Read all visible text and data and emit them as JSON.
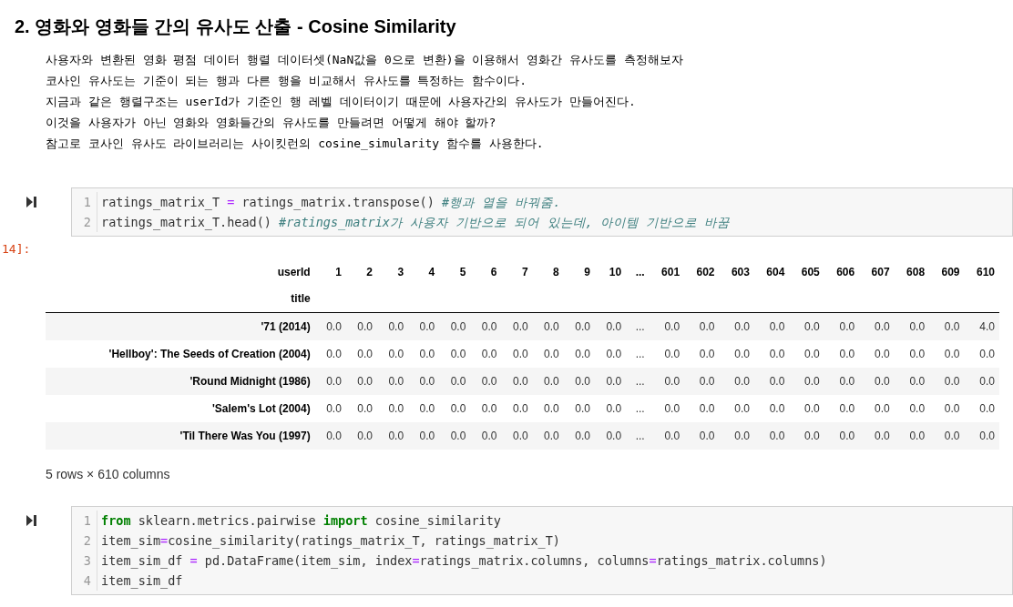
{
  "heading": "2. 영화와 영화들 간의 유사도 산출 - Cosine Similarity",
  "paragraphs": [
    "사용자와 변환된 영화 평점 데이터 행렬 데이터셋(NaN값을 0으로 변환)을 이용해서 영화간 유사도를 측정해보자",
    "코사인 유사도는 기준이 되는 행과 다른 행을 비교해서 유사도를 특정하는 함수이다.",
    "지금과 같은 행렬구조는 userId가 기준인 행 레벨 데이터이기 때문에 사용자간의 유사도가 만들어진다.",
    "이것을 사용자가 아닌 영화와 영화들간의 유사도를 만들려면 어떻게 해야 할까?",
    "참고로 코사인 유사도 라이브러리는 사이킷런의 cosine_simularity 함수를 사용한다."
  ],
  "cells": [
    {
      "prompt": "14]:",
      "lines": [
        {
          "number": "1",
          "tokens": [
            {
              "kind": "plain",
              "text": "ratings_matrix_T "
            },
            {
              "kind": "operator",
              "text": "="
            },
            {
              "kind": "plain",
              "text": " ratings_matrix.transpose() "
            },
            {
              "kind": "comment",
              "text": "#행과 열을 바꿔줌."
            }
          ]
        },
        {
          "number": "2",
          "tokens": [
            {
              "kind": "plain",
              "text": "ratings_matrix_T.head() "
            },
            {
              "kind": "comment",
              "text": "#ratings_matrix가 사용자 기반으로 되어 있는데, 아이템 기반으로 바꿈"
            }
          ]
        }
      ],
      "output": {
        "table": {
          "columns_name": "userId",
          "index_name": "title",
          "columns": [
            "1",
            "2",
            "3",
            "4",
            "5",
            "6",
            "7",
            "8",
            "9",
            "10",
            "...",
            "601",
            "602",
            "603",
            "604",
            "605",
            "606",
            "607",
            "608",
            "609",
            "610"
          ],
          "rows": [
            {
              "index": "'71 (2014)",
              "values": [
                "0.0",
                "0.0",
                "0.0",
                "0.0",
                "0.0",
                "0.0",
                "0.0",
                "0.0",
                "0.0",
                "0.0",
                "...",
                "0.0",
                "0.0",
                "0.0",
                "0.0",
                "0.0",
                "0.0",
                "0.0",
                "0.0",
                "0.0",
                "4.0"
              ]
            },
            {
              "index": "'Hellboy': The Seeds of Creation (2004)",
              "values": [
                "0.0",
                "0.0",
                "0.0",
                "0.0",
                "0.0",
                "0.0",
                "0.0",
                "0.0",
                "0.0",
                "0.0",
                "...",
                "0.0",
                "0.0",
                "0.0",
                "0.0",
                "0.0",
                "0.0",
                "0.0",
                "0.0",
                "0.0",
                "0.0"
              ]
            },
            {
              "index": "'Round Midnight (1986)",
              "values": [
                "0.0",
                "0.0",
                "0.0",
                "0.0",
                "0.0",
                "0.0",
                "0.0",
                "0.0",
                "0.0",
                "0.0",
                "...",
                "0.0",
                "0.0",
                "0.0",
                "0.0",
                "0.0",
                "0.0",
                "0.0",
                "0.0",
                "0.0",
                "0.0"
              ]
            },
            {
              "index": "'Salem's Lot (2004)",
              "values": [
                "0.0",
                "0.0",
                "0.0",
                "0.0",
                "0.0",
                "0.0",
                "0.0",
                "0.0",
                "0.0",
                "0.0",
                "...",
                "0.0",
                "0.0",
                "0.0",
                "0.0",
                "0.0",
                "0.0",
                "0.0",
                "0.0",
                "0.0",
                "0.0"
              ]
            },
            {
              "index": "'Til There Was You (1997)",
              "values": [
                "0.0",
                "0.0",
                "0.0",
                "0.0",
                "0.0",
                "0.0",
                "0.0",
                "0.0",
                "0.0",
                "0.0",
                "...",
                "0.0",
                "0.0",
                "0.0",
                "0.0",
                "0.0",
                "0.0",
                "0.0",
                "0.0",
                "0.0",
                "0.0"
              ]
            }
          ],
          "shape": "5 rows × 610 columns"
        }
      }
    },
    {
      "lines": [
        {
          "number": "1",
          "tokens": [
            {
              "kind": "keyword",
              "text": "from"
            },
            {
              "kind": "plain",
              "text": " sklearn.metrics.pairwise "
            },
            {
              "kind": "keyword",
              "text": "import"
            },
            {
              "kind": "plain",
              "text": " cosine_similarity"
            }
          ]
        },
        {
          "number": "2",
          "tokens": [
            {
              "kind": "plain",
              "text": "item_sim"
            },
            {
              "kind": "operator",
              "text": "="
            },
            {
              "kind": "plain",
              "text": "cosine_similarity(ratings_matrix_T, ratings_matrix_T)"
            }
          ]
        },
        {
          "number": "3",
          "tokens": [
            {
              "kind": "plain",
              "text": "item_sim_df "
            },
            {
              "kind": "operator",
              "text": "="
            },
            {
              "kind": "plain",
              "text": " pd.DataFrame(item_sim, index"
            },
            {
              "kind": "operator",
              "text": "="
            },
            {
              "kind": "plain",
              "text": "ratings_matrix.columns, columns"
            },
            {
              "kind": "operator",
              "text": "="
            },
            {
              "kind": "plain",
              "text": "ratings_matrix.columns)"
            }
          ]
        },
        {
          "number": "4",
          "tokens": [
            {
              "kind": "plain",
              "text": "item_sim_df"
            }
          ]
        }
      ]
    }
  ]
}
